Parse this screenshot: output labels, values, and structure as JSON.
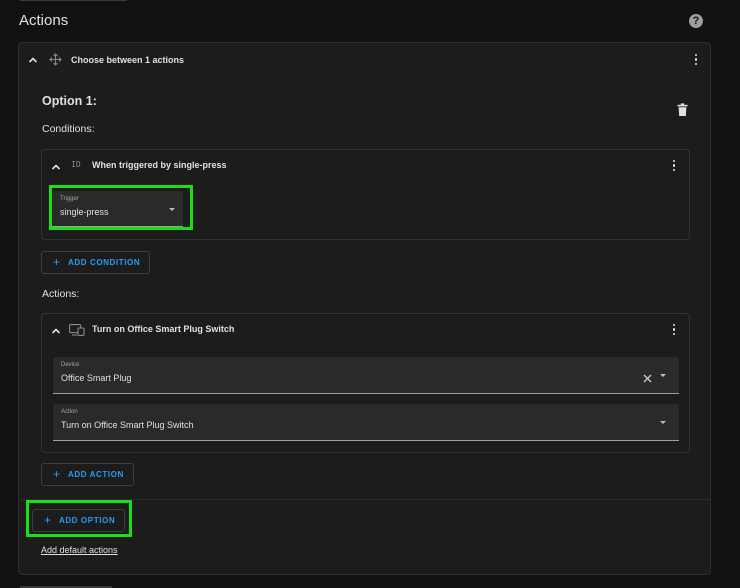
{
  "section_title": "Actions",
  "choose": {
    "title": "Choose between 1 actions",
    "option": {
      "title": "Option 1:",
      "conditions_label": "Conditions:",
      "condition": {
        "title": "When triggered by single-press",
        "trigger_field": {
          "label": "Trigger",
          "value": "single-press"
        }
      },
      "add_condition_label": "ADD CONDITION",
      "actions_label": "Actions:",
      "action": {
        "title": "Turn on Office Smart Plug Switch",
        "device_field": {
          "label": "Device",
          "value": "Office Smart Plug"
        },
        "action_field": {
          "label": "Action",
          "value": "Turn on Office Smart Plug Switch"
        }
      },
      "add_action_label": "ADD ACTION"
    },
    "add_option_label": "ADD OPTION",
    "add_default_actions_label": "Add default actions"
  },
  "colors": {
    "accent": "#2a9cf0",
    "highlight": "#1bdf16",
    "background": "#111111",
    "card": "#1c1c1c"
  },
  "icons": [
    "help-icon",
    "chevron-up-icon",
    "choose-icon",
    "more-vert-icon",
    "trash-icon",
    "id-icon",
    "device-icon",
    "plus-icon",
    "clear-icon",
    "dropdown-icon"
  ]
}
